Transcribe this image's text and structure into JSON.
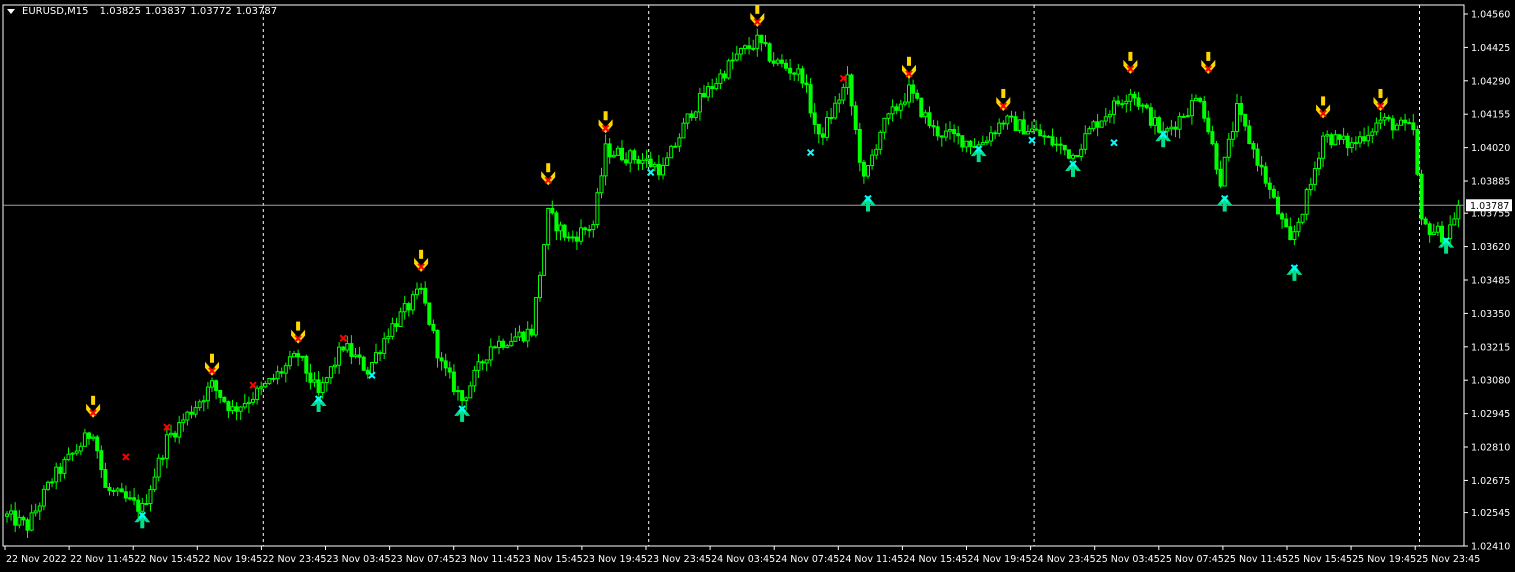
{
  "header": {
    "symbol": "EURUSD,M15",
    "open": "1.03825",
    "high": "1.03837",
    "low": "1.03772",
    "close": "1.03787"
  },
  "colors": {
    "candle": "#00ff00",
    "price_line": "#a0a0a0",
    "sell_arrow": "#ffd700",
    "sell_mark": "#ff0000",
    "buy_arrow": "#00e08a",
    "cyan_mark": "#00ffff"
  },
  "chart_data": {
    "type": "candlestick",
    "ylim": [
      1.0241,
      1.0456
    ],
    "price_ticks": [
      "1.04560",
      "1.04425",
      "1.04290",
      "1.04155",
      "1.04020",
      "1.03885",
      "1.03755",
      "1.03620",
      "1.03485",
      "1.03350",
      "1.03215",
      "1.03080",
      "1.02945",
      "1.02810",
      "1.02675",
      "1.02545",
      "1.02410"
    ],
    "current_price": "1.03787",
    "time_labels": [
      "22 Nov 2022",
      "22 Nov 11:45",
      "22 Nov 15:45",
      "22 Nov 19:45",
      "22 Nov 23:45",
      "23 Nov 03:45",
      "23 Nov 07:45",
      "23 Nov 11:45",
      "23 Nov 15:45",
      "23 Nov 19:45",
      "23 Nov 23:45",
      "24 Nov 03:45",
      "24 Nov 07:45",
      "24 Nov 11:45",
      "24 Nov 15:45",
      "24 Nov 19:45",
      "24 Nov 23:45",
      "25 Nov 03:45",
      "25 Nov 07:45",
      "25 Nov 11:45",
      "25 Nov 15:45",
      "25 Nov 19:45",
      "25 Nov 23:45"
    ],
    "day_separators_bar": [
      63,
      157,
      251,
      345
    ],
    "price_path": [
      [
        0,
        1.0253
      ],
      [
        5,
        1.0249
      ],
      [
        11,
        1.0268
      ],
      [
        21,
        1.0288
      ],
      [
        24,
        1.0264
      ],
      [
        33,
        1.0256
      ],
      [
        39,
        1.0284
      ],
      [
        50,
        1.0306
      ],
      [
        55,
        1.0296
      ],
      [
        62,
        1.0304
      ],
      [
        71,
        1.0318
      ],
      [
        76,
        1.0302
      ],
      [
        82,
        1.0322
      ],
      [
        88,
        1.0312
      ],
      [
        93,
        1.0328
      ],
      [
        101,
        1.0344
      ],
      [
        106,
        1.0314
      ],
      [
        111,
        1.03
      ],
      [
        118,
        1.0322
      ],
      [
        128,
        1.0328
      ],
      [
        132,
        1.0375
      ],
      [
        137,
        1.0365
      ],
      [
        143,
        1.0371
      ],
      [
        146,
        1.0401
      ],
      [
        155,
        1.0397
      ],
      [
        160,
        1.0393
      ],
      [
        167,
        1.0417
      ],
      [
        178,
        1.0439
      ],
      [
        183,
        1.0445
      ],
      [
        187,
        1.0437
      ],
      [
        194,
        1.0431
      ],
      [
        198,
        1.0405
      ],
      [
        205,
        1.0429
      ],
      [
        209,
        1.0388
      ],
      [
        213,
        1.0409
      ],
      [
        220,
        1.0425
      ],
      [
        226,
        1.0409
      ],
      [
        237,
        1.0403
      ],
      [
        243,
        1.0413
      ],
      [
        250,
        1.0409
      ],
      [
        260,
        1.0399
      ],
      [
        265,
        1.0411
      ],
      [
        274,
        1.0425
      ],
      [
        282,
        1.0407
      ],
      [
        291,
        1.0423
      ],
      [
        296,
        1.0389
      ],
      [
        300,
        1.0417
      ],
      [
        306,
        1.0393
      ],
      [
        313,
        1.0363
      ],
      [
        318,
        1.0387
      ],
      [
        321,
        1.0407
      ],
      [
        328,
        1.0403
      ],
      [
        335,
        1.0413
      ],
      [
        343,
        1.0409
      ],
      [
        345,
        1.0371
      ],
      [
        351,
        1.0366
      ],
      [
        354,
        1.03787
      ]
    ],
    "signals": {
      "sell_arrows": [
        [
          21,
          1.0292
        ],
        [
          50,
          1.0309
        ],
        [
          71,
          1.0322
        ],
        [
          101,
          1.0351
        ],
        [
          132,
          1.0386
        ],
        [
          146,
          1.0407
        ],
        [
          183,
          1.045
        ],
        [
          220,
          1.0429
        ],
        [
          243,
          1.0416
        ],
        [
          274,
          1.0431
        ],
        [
          293,
          1.0431
        ],
        [
          321,
          1.0413
        ],
        [
          335,
          1.0416
        ]
      ],
      "sell_marks": [
        [
          29,
          1.0277
        ],
        [
          39,
          1.0289
        ],
        [
          60,
          1.0306
        ],
        [
          82,
          1.0325
        ],
        [
          204,
          1.043
        ]
      ],
      "cyan_marks": [
        [
          89,
          1.031
        ],
        [
          157,
          1.0392
        ],
        [
          196,
          1.04
        ],
        [
          250,
          1.0405
        ],
        [
          270,
          1.0404
        ]
      ],
      "buy_arrows": [
        [
          33,
          1.0253
        ],
        [
          76,
          1.03
        ],
        [
          111,
          1.0296
        ],
        [
          210,
          1.0381
        ],
        [
          237,
          1.0401
        ],
        [
          260,
          1.0395
        ],
        [
          282,
          1.0407
        ],
        [
          297,
          1.0381
        ],
        [
          314,
          1.0353
        ],
        [
          351,
          1.0364
        ]
      ]
    }
  }
}
